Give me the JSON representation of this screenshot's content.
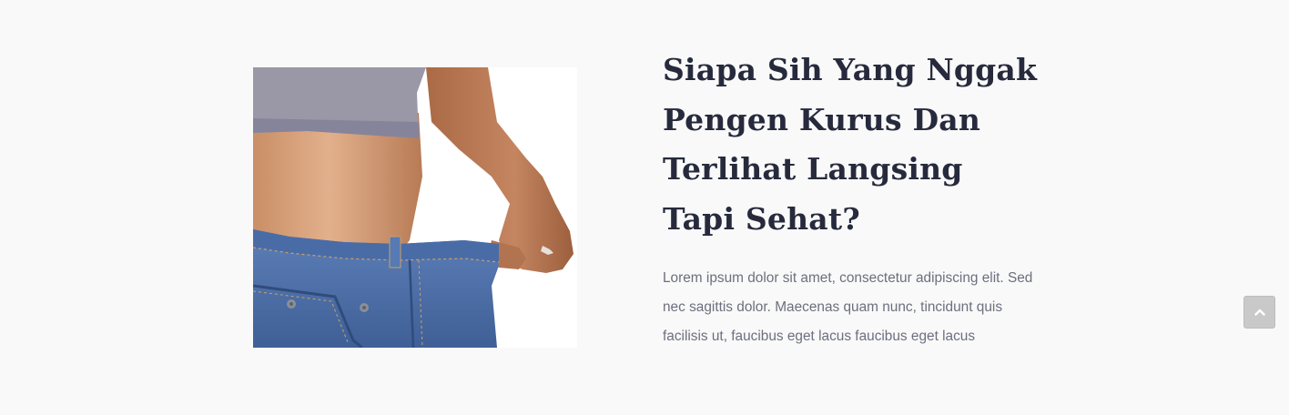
{
  "hero": {
    "image_alt": "Perempuan mengenakan celana jeans yang kebesaran",
    "headline": "Siapa Sih Yang Nggak Pengen Kurus Dan Terlihat Langsing Tapi Sehat?",
    "body": "Lorem ipsum dolor sit amet, consectetur adipiscing elit. Sed nec sagittis dolor. Maecenas quam nunc, tincidunt quis facilisis ut, faucibus eget lacus faucibus eget lacus"
  },
  "scroll_top": {
    "icon": "chevron-up-icon",
    "aria_label": "Scroll to top"
  },
  "colors": {
    "page_background": "#f9f9f9",
    "headline": "#262a3c",
    "body_text": "#6c6f7e",
    "scroll_button": "#c9c9c9"
  }
}
